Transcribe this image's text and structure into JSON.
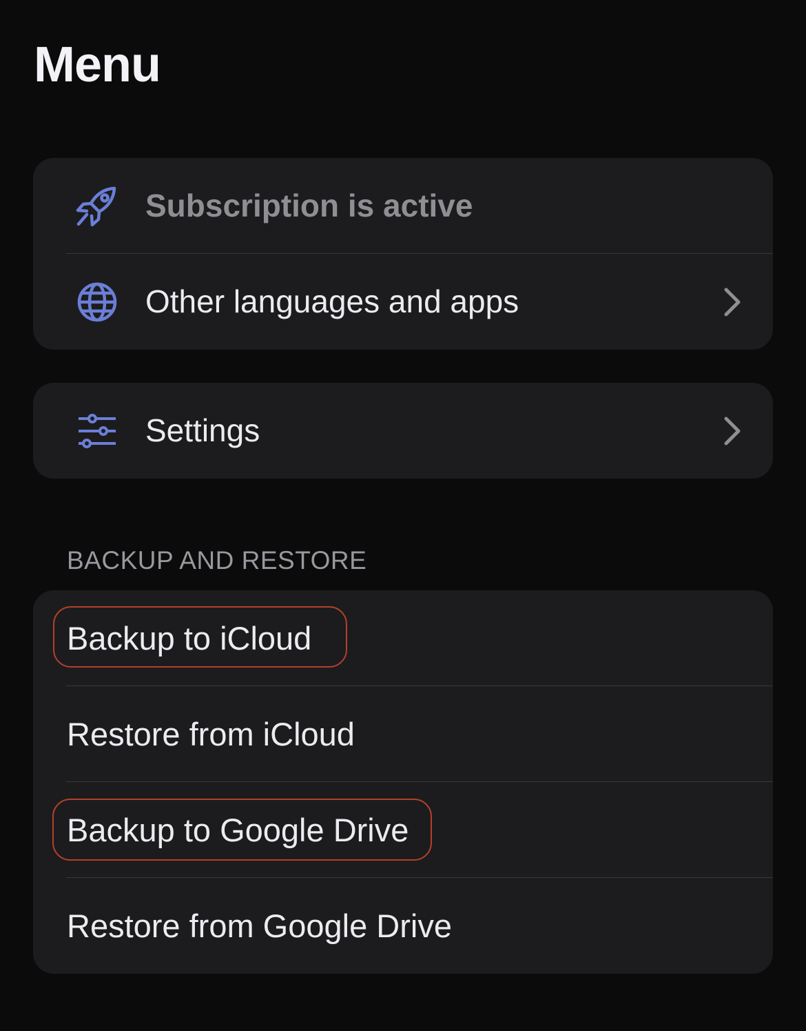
{
  "header": {
    "title": "Menu"
  },
  "top_group": {
    "items": [
      {
        "icon": "rocket-icon",
        "label": "Subscription is active",
        "has_chevron": false
      },
      {
        "icon": "globe-icon",
        "label": "Other languages and apps",
        "has_chevron": true
      }
    ]
  },
  "settings_group": {
    "items": [
      {
        "icon": "sliders-icon",
        "label": "Settings",
        "has_chevron": true
      }
    ]
  },
  "backup_section": {
    "header": "BACKUP AND RESTORE",
    "items": [
      {
        "label": "Backup to iCloud",
        "highlighted": true
      },
      {
        "label": "Restore from iCloud",
        "highlighted": false
      },
      {
        "label": "Backup to Google Drive",
        "highlighted": true
      },
      {
        "label": "Restore from Google Drive",
        "highlighted": false
      }
    ]
  },
  "colors": {
    "background": "#0b0b0c",
    "card": "#1c1c1e",
    "icon_accent": "#6b7fd7",
    "highlight_outline": "#b5402c",
    "chevron": "#8e8e93"
  }
}
